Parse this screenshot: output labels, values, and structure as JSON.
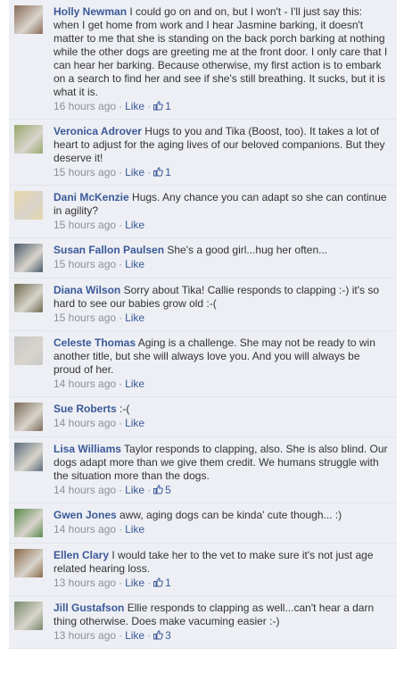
{
  "comments": [
    {
      "name": "Holly Newman",
      "text": "I could go on and on, but I won't - I'll just say this: when I get home from work and I hear Jasmine barking, it doesn't matter to me that she is standing on the back porch barking at nothing while the other dogs are greeting me at the front door. I only care that I can hear her barking. Because otherwise, my first action is to embark on a search to find her and see if she's still breathing. It sucks, but it is what it is.",
      "time": "16 hours ago",
      "like": "Like",
      "likes": "1",
      "avatar_color": "#8a6a58"
    },
    {
      "name": "Veronica Adrover",
      "text": "Hugs to you and Tika (Boost, too). It takes a lot of heart to adjust for the aging lives of our beloved companions. But they deserve it!",
      "time": "15 hours ago",
      "like": "Like",
      "likes": "1",
      "avatar_color": "#9aa86a"
    },
    {
      "name": "Dani McKenzie",
      "text": "Hugs. Any chance you can adapt so she can continue in agility?",
      "time": "15 hours ago",
      "like": "Like",
      "likes": "",
      "avatar_color": "#e6d6a8"
    },
    {
      "name": "Susan Fallon Paulsen",
      "text": "She's a good girl...hug her often...",
      "time": "15 hours ago",
      "like": "Like",
      "likes": "",
      "avatar_color": "#4a5a6a"
    },
    {
      "name": "Diana Wilson",
      "text": "Sorry about Tika! Callie responds to clapping :-) it's so hard to see our babies grow old :-(",
      "time": "15 hours ago",
      "like": "Like",
      "likes": "",
      "avatar_color": "#6b6a4c"
    },
    {
      "name": "Celeste Thomas",
      "text": "Aging is a challenge. She may not be ready to win another title, but she will always love you. And you will always be proud of her.",
      "time": "14 hours ago",
      "like": "Like",
      "likes": "",
      "avatar_color": "#c8c8c8"
    },
    {
      "name": "Sue Roberts",
      "text": ":-(",
      "time": "14 hours ago",
      "like": "Like",
      "likes": "",
      "avatar_color": "#7a6a58"
    },
    {
      "name": "Lisa Williams",
      "text": "Taylor responds to clapping, also. She is also blind. Our dogs adapt more than we give them credit. We humans struggle with the situation more than the dogs.",
      "time": "14 hours ago",
      "like": "Like",
      "likes": "5",
      "avatar_color": "#5a6a7a"
    },
    {
      "name": "Gwen Jones",
      "text": "aww, aging dogs can be kinda' cute though... :)",
      "time": "14 hours ago",
      "like": "Like",
      "likes": "",
      "avatar_color": "#5a8a4a"
    },
    {
      "name": "Ellen Clary",
      "text": "I would take her to the vet to make sure it's not just age related hearing loss.",
      "time": "13 hours ago",
      "like": "Like",
      "likes": "1",
      "avatar_color": "#8a6a4a"
    },
    {
      "name": "Jill Gustafson",
      "text": "Ellie responds to clapping as well...can't hear a darn thing otherwise. Does make vacuming easier :-)",
      "time": "13 hours ago",
      "like": "Like",
      "likes": "3",
      "avatar_color": "#7a8a6a"
    }
  ],
  "icons": {
    "avatar": "profile-photo",
    "likes": "thumbs-up-icon"
  },
  "colors": {
    "link": "#3b5998",
    "meta": "#89919c",
    "background": "#edeff4"
  }
}
